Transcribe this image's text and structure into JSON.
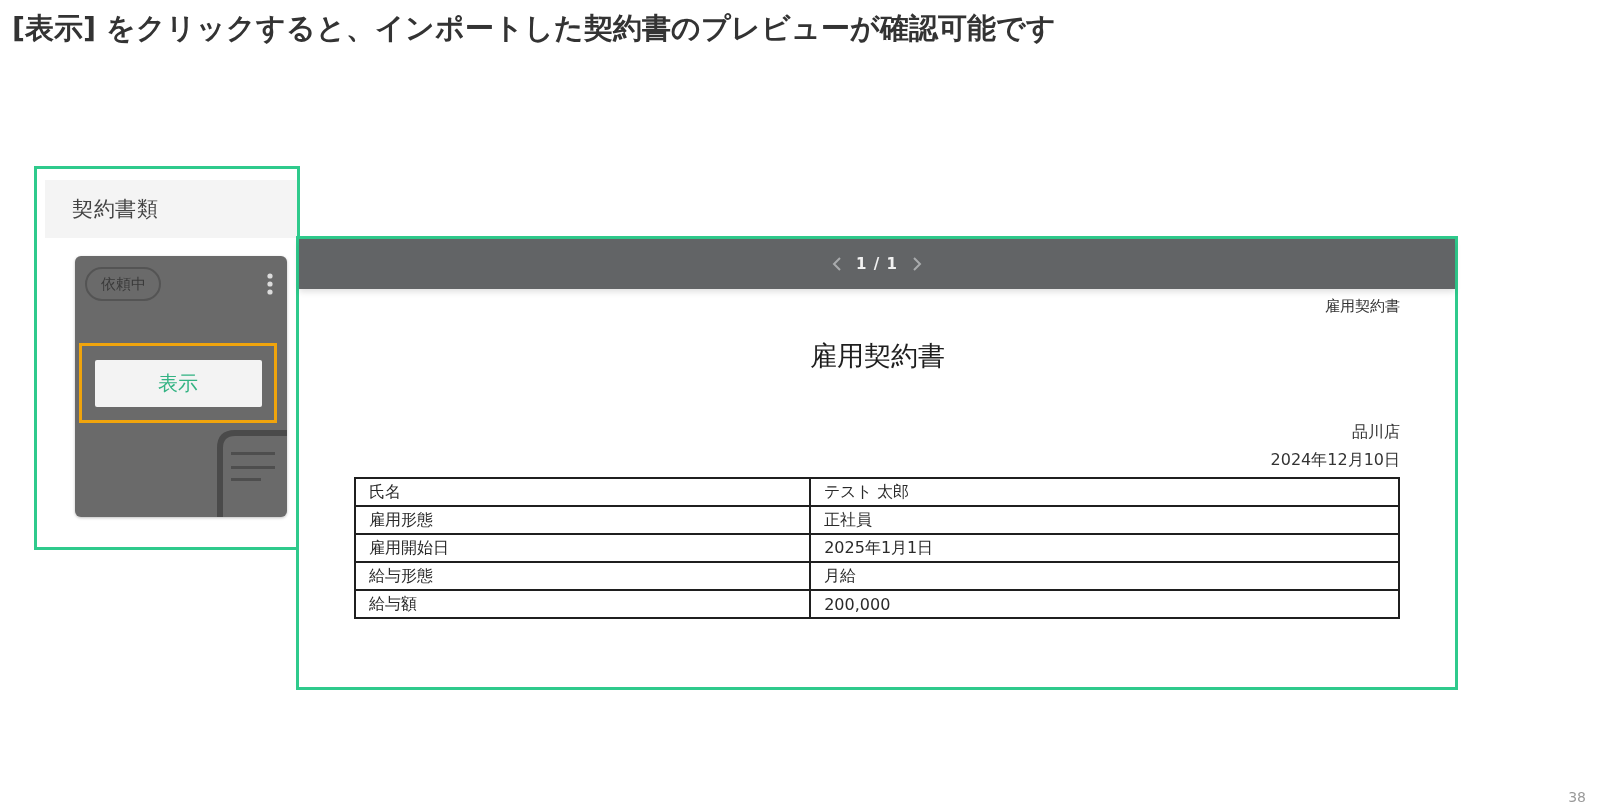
{
  "heading": "[表示] をクリックすると、インポートした契約書のプレビューが確認可能です",
  "documents_panel": {
    "title": "契約書類",
    "card": {
      "status": "依頼中",
      "button": "表示",
      "highlighted": true
    }
  },
  "preview": {
    "pager": {
      "page": "1 / 1"
    },
    "document": {
      "header_note": "雇用契約書",
      "title": "雇用契約書",
      "store": "品川店",
      "date": "2024年12月10日",
      "rows": [
        {
          "label": "氏名",
          "value": "テスト 太郎"
        },
        {
          "label": "雇用形態",
          "value": "正社員"
        },
        {
          "label": "雇用開始日",
          "value": "2025年1月1日"
        },
        {
          "label": "給与形態",
          "value": "月給"
        },
        {
          "label": "給与額",
          "value": "200,000"
        }
      ]
    }
  },
  "page_number": "38"
}
